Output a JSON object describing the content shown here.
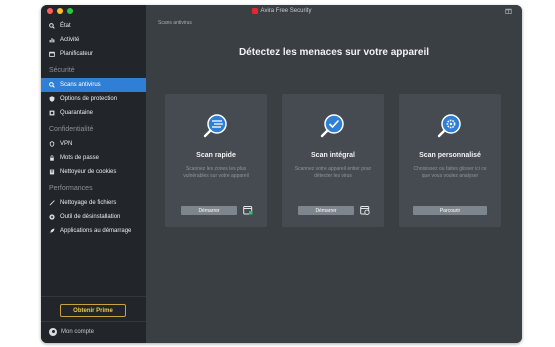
{
  "window": {
    "title": "Avira Free Security"
  },
  "colors": {
    "accent": "#2f7fd6",
    "sidebar_bg": "#22262a",
    "main_bg": "#3a3f44",
    "card_bg": "#454b51",
    "prime": "#f2c94c",
    "brand_red": "#e0282e"
  },
  "sidebar": {
    "items_top": [
      {
        "label": "État",
        "icon": "search-icon"
      },
      {
        "label": "Activité",
        "icon": "bar-chart-icon"
      },
      {
        "label": "Planificateur",
        "icon": "calendar-icon"
      }
    ],
    "section_security": "Sécurité",
    "items_security": [
      {
        "label": "Scans antivirus",
        "icon": "search-icon",
        "active": true
      },
      {
        "label": "Options de protection",
        "icon": "shield-icon"
      },
      {
        "label": "Quarantaine",
        "icon": "quarantine-icon"
      }
    ],
    "section_privacy": "Confidentialité",
    "items_privacy": [
      {
        "label": "VPN",
        "icon": "vpn-icon"
      },
      {
        "label": "Mots de passe",
        "icon": "lock-icon"
      },
      {
        "label": "Nettoyeur de cookies",
        "icon": "cookie-icon"
      }
    ],
    "section_performance": "Performances",
    "items_performance": [
      {
        "label": "Nettoyage de fichiers",
        "icon": "broom-icon"
      },
      {
        "label": "Outil de désinstallation",
        "icon": "uninstall-icon"
      },
      {
        "label": "Applications au démarrage",
        "icon": "rocket-icon"
      }
    ],
    "prime_button": "Obtenir Prime",
    "account": "Mon compte"
  },
  "main": {
    "breadcrumb": "Scans antivirus",
    "headline": "Détectez les menaces sur votre appareil",
    "cards": [
      {
        "title": "Scan rapide",
        "description": "Scannez les zones les plus vulnérables sur votre appareil",
        "button": "Démarrer",
        "icon": "fast-scan-icon",
        "schedule_icon": "calendar-add-icon"
      },
      {
        "title": "Scan intégral",
        "description": "Scannez votre appareil entier pour détecter les virus",
        "button": "Démarrer",
        "icon": "full-scan-icon",
        "schedule_icon": "calendar-clock-icon"
      },
      {
        "title": "Scan personnalisé",
        "description": "Choisissez ou faites glisser ici ce que vous voulez analyser",
        "button": "Parcourir",
        "icon": "custom-scan-icon"
      }
    ]
  }
}
